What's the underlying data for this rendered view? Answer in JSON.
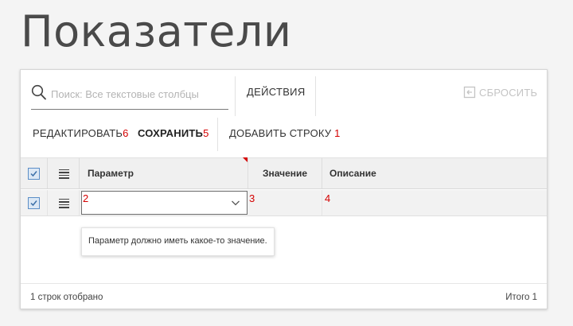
{
  "page": {
    "title": "Показатели"
  },
  "toolbar": {
    "search_placeholder": "Поиск: Все текстовые столбцы",
    "actions_label": "ДЕЙСТВИЯ",
    "reset_label": "СБРОСИТЬ",
    "edit_label": "РЕДАКТИРОВАТЬ",
    "edit_num": "6",
    "save_label": "СОХРАНИТЬ",
    "save_num": "5",
    "add_row_label": "ДОБАВИТЬ СТРОКУ",
    "add_row_num": "1"
  },
  "grid": {
    "columns": [
      "Параметр",
      "Значение",
      "Описание"
    ],
    "row_markers": {
      "param": "2",
      "value": "3",
      "description": "4"
    },
    "row_selected": true,
    "header_selected": true,
    "param_value": ""
  },
  "tooltip": {
    "text": "Параметр должно иметь какое-то значение."
  },
  "footer": {
    "rows_shown": "1 строк отобрано",
    "total": "Итого 1"
  },
  "colors": {
    "accent_red": "#d40000",
    "checkbox_blue": "#5b8ec7"
  }
}
